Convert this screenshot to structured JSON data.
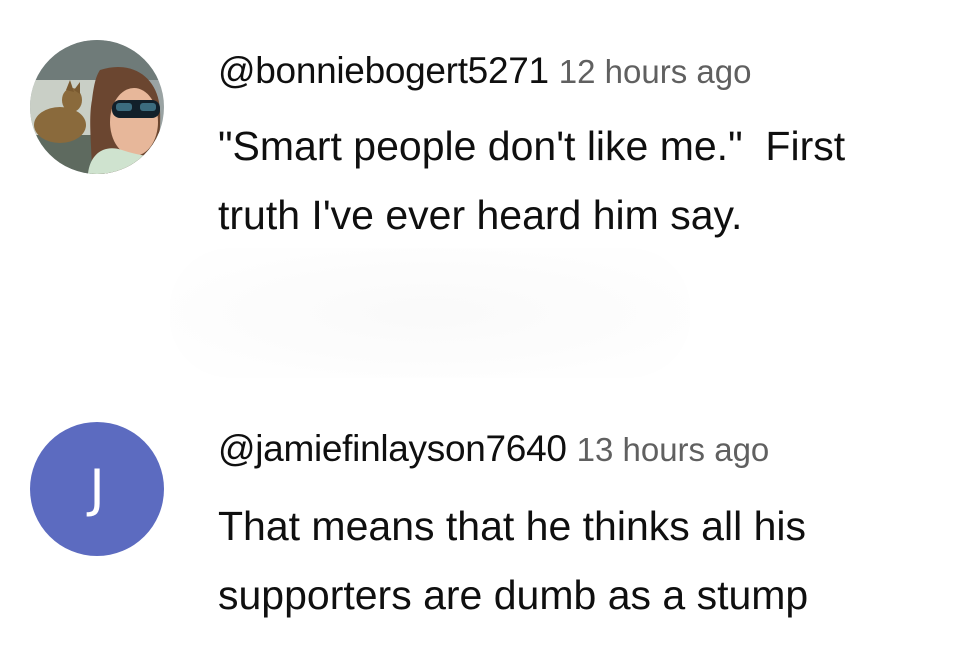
{
  "comments": [
    {
      "avatar_type": "photo",
      "handle": "@bonniebogert5271",
      "time": "12 hours ago",
      "lines": [
        "\"Smart people don't like me.\"  First",
        "truth I've ever heard him say."
      ]
    },
    {
      "avatar_type": "initial",
      "avatar_initial": "J",
      "avatar_color": "#5c6bc0",
      "handle": "@jamiefinlayson7640",
      "time": "13 hours ago",
      "lines": [
        "That means that he thinks all his",
        "supporters are dumb as a stump"
      ]
    }
  ],
  "colors": {
    "text": "#0f0f0f",
    "secondary": "#606060",
    "background": "#ffffff"
  }
}
